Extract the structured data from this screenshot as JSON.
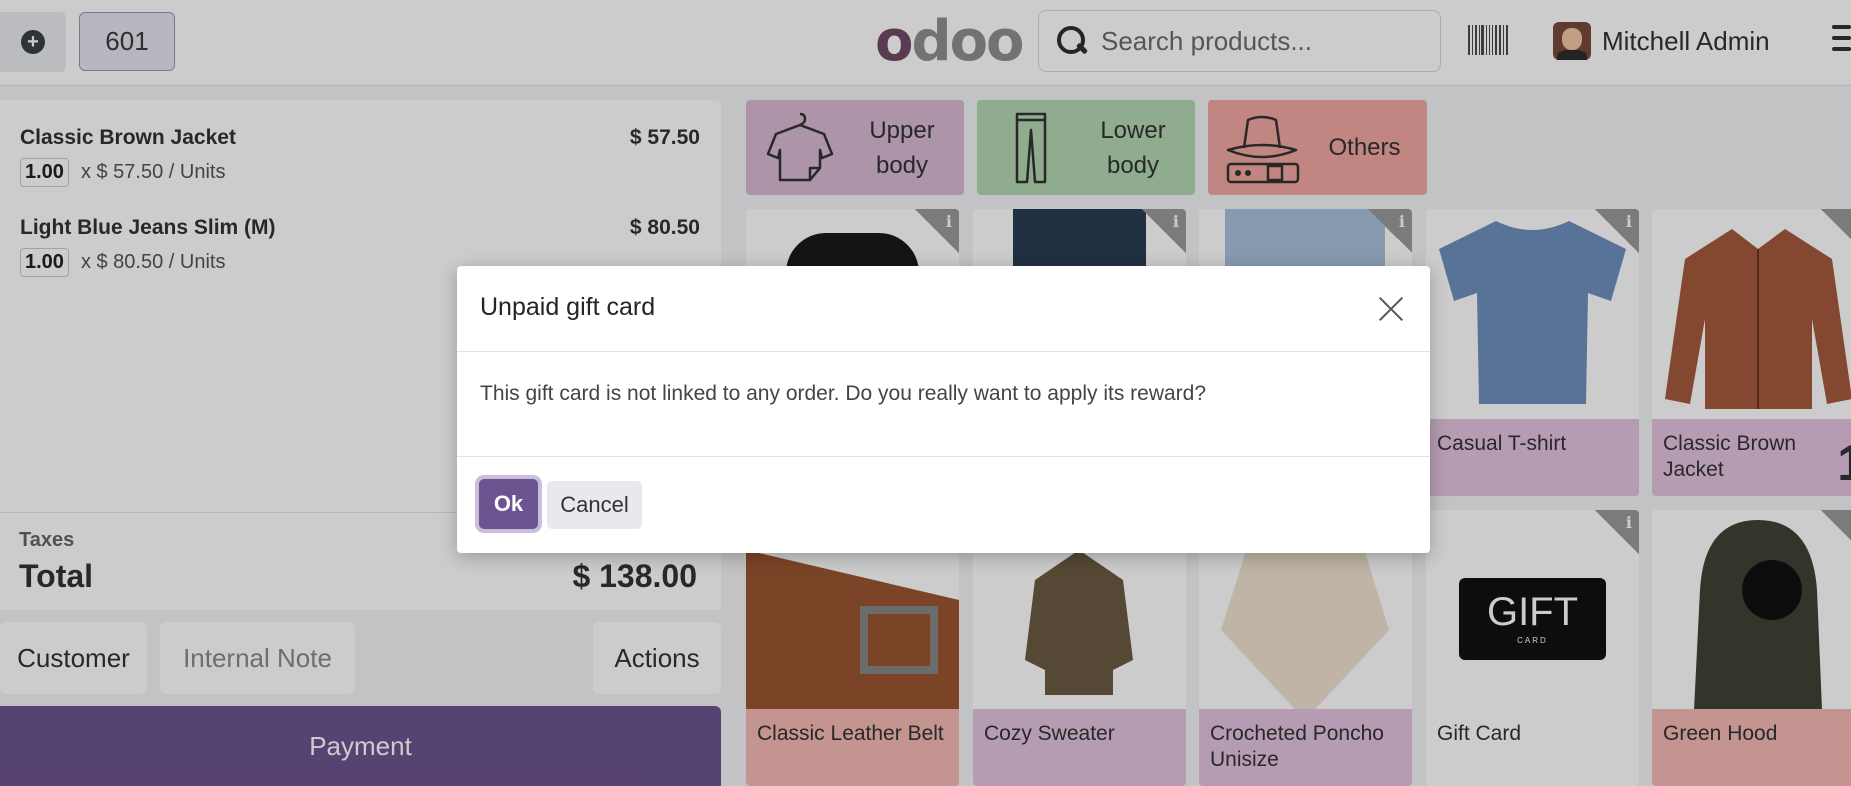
{
  "topbar": {
    "new_order_icon": "plus-circle-icon",
    "order_number": "601",
    "logo_text": "odoo",
    "search_placeholder": "Search products...",
    "user_name": "Mitchell Admin"
  },
  "orderlines": [
    {
      "name": "Classic Brown Jacket",
      "price": "$ 57.50",
      "qty": "1.00",
      "unit_price": "x $ 57.50 / Units"
    },
    {
      "name": "Light Blue Jeans Slim (M)",
      "price": "$ 80.50",
      "qty": "1.00",
      "unit_price": "x $ 80.50 / Units"
    }
  ],
  "totals": {
    "taxes_label": "Taxes",
    "total_label": "Total",
    "total_value": "$ 138.00"
  },
  "controls": {
    "customer": "Customer",
    "internal_note": "Internal Note",
    "actions": "Actions",
    "payment": "Payment"
  },
  "categories": [
    {
      "label_line1": "Upper",
      "label_line2": "body",
      "color": "#d9b9d4",
      "icon": "shirt-icon"
    },
    {
      "label_line1": "Lower",
      "label_line2": "body",
      "color": "#b4d7b3",
      "icon": "pants-icon"
    },
    {
      "label_line1": "Others",
      "label_line2": "",
      "color": "#f3a8a3",
      "icon": "hat-icon"
    }
  ],
  "products": [
    {
      "name": "Casual T-shirt",
      "color": "#e4c4df"
    },
    {
      "name": "Classic Brown Jacket",
      "color": "#e4c4df",
      "badge": "1"
    },
    {
      "name": "Classic Leather Belt",
      "color": "#f4b9b4"
    },
    {
      "name": "Cozy Sweater",
      "color": "#e4c4df"
    },
    {
      "name": "Crocheted Poncho Unisize",
      "color": "#e4c4df"
    },
    {
      "name": "Gift Card",
      "color": "#ffffff",
      "gift_text": "GIFT",
      "gift_sub": "CARD"
    },
    {
      "name": "Green Hood",
      "color": "#f4b9b4"
    }
  ],
  "dialog": {
    "title": "Unpaid gift card",
    "body": "This gift card is not linked to any order. Do you really want to apply its reward?",
    "ok_label": "Ok",
    "cancel_label": "Cancel"
  }
}
